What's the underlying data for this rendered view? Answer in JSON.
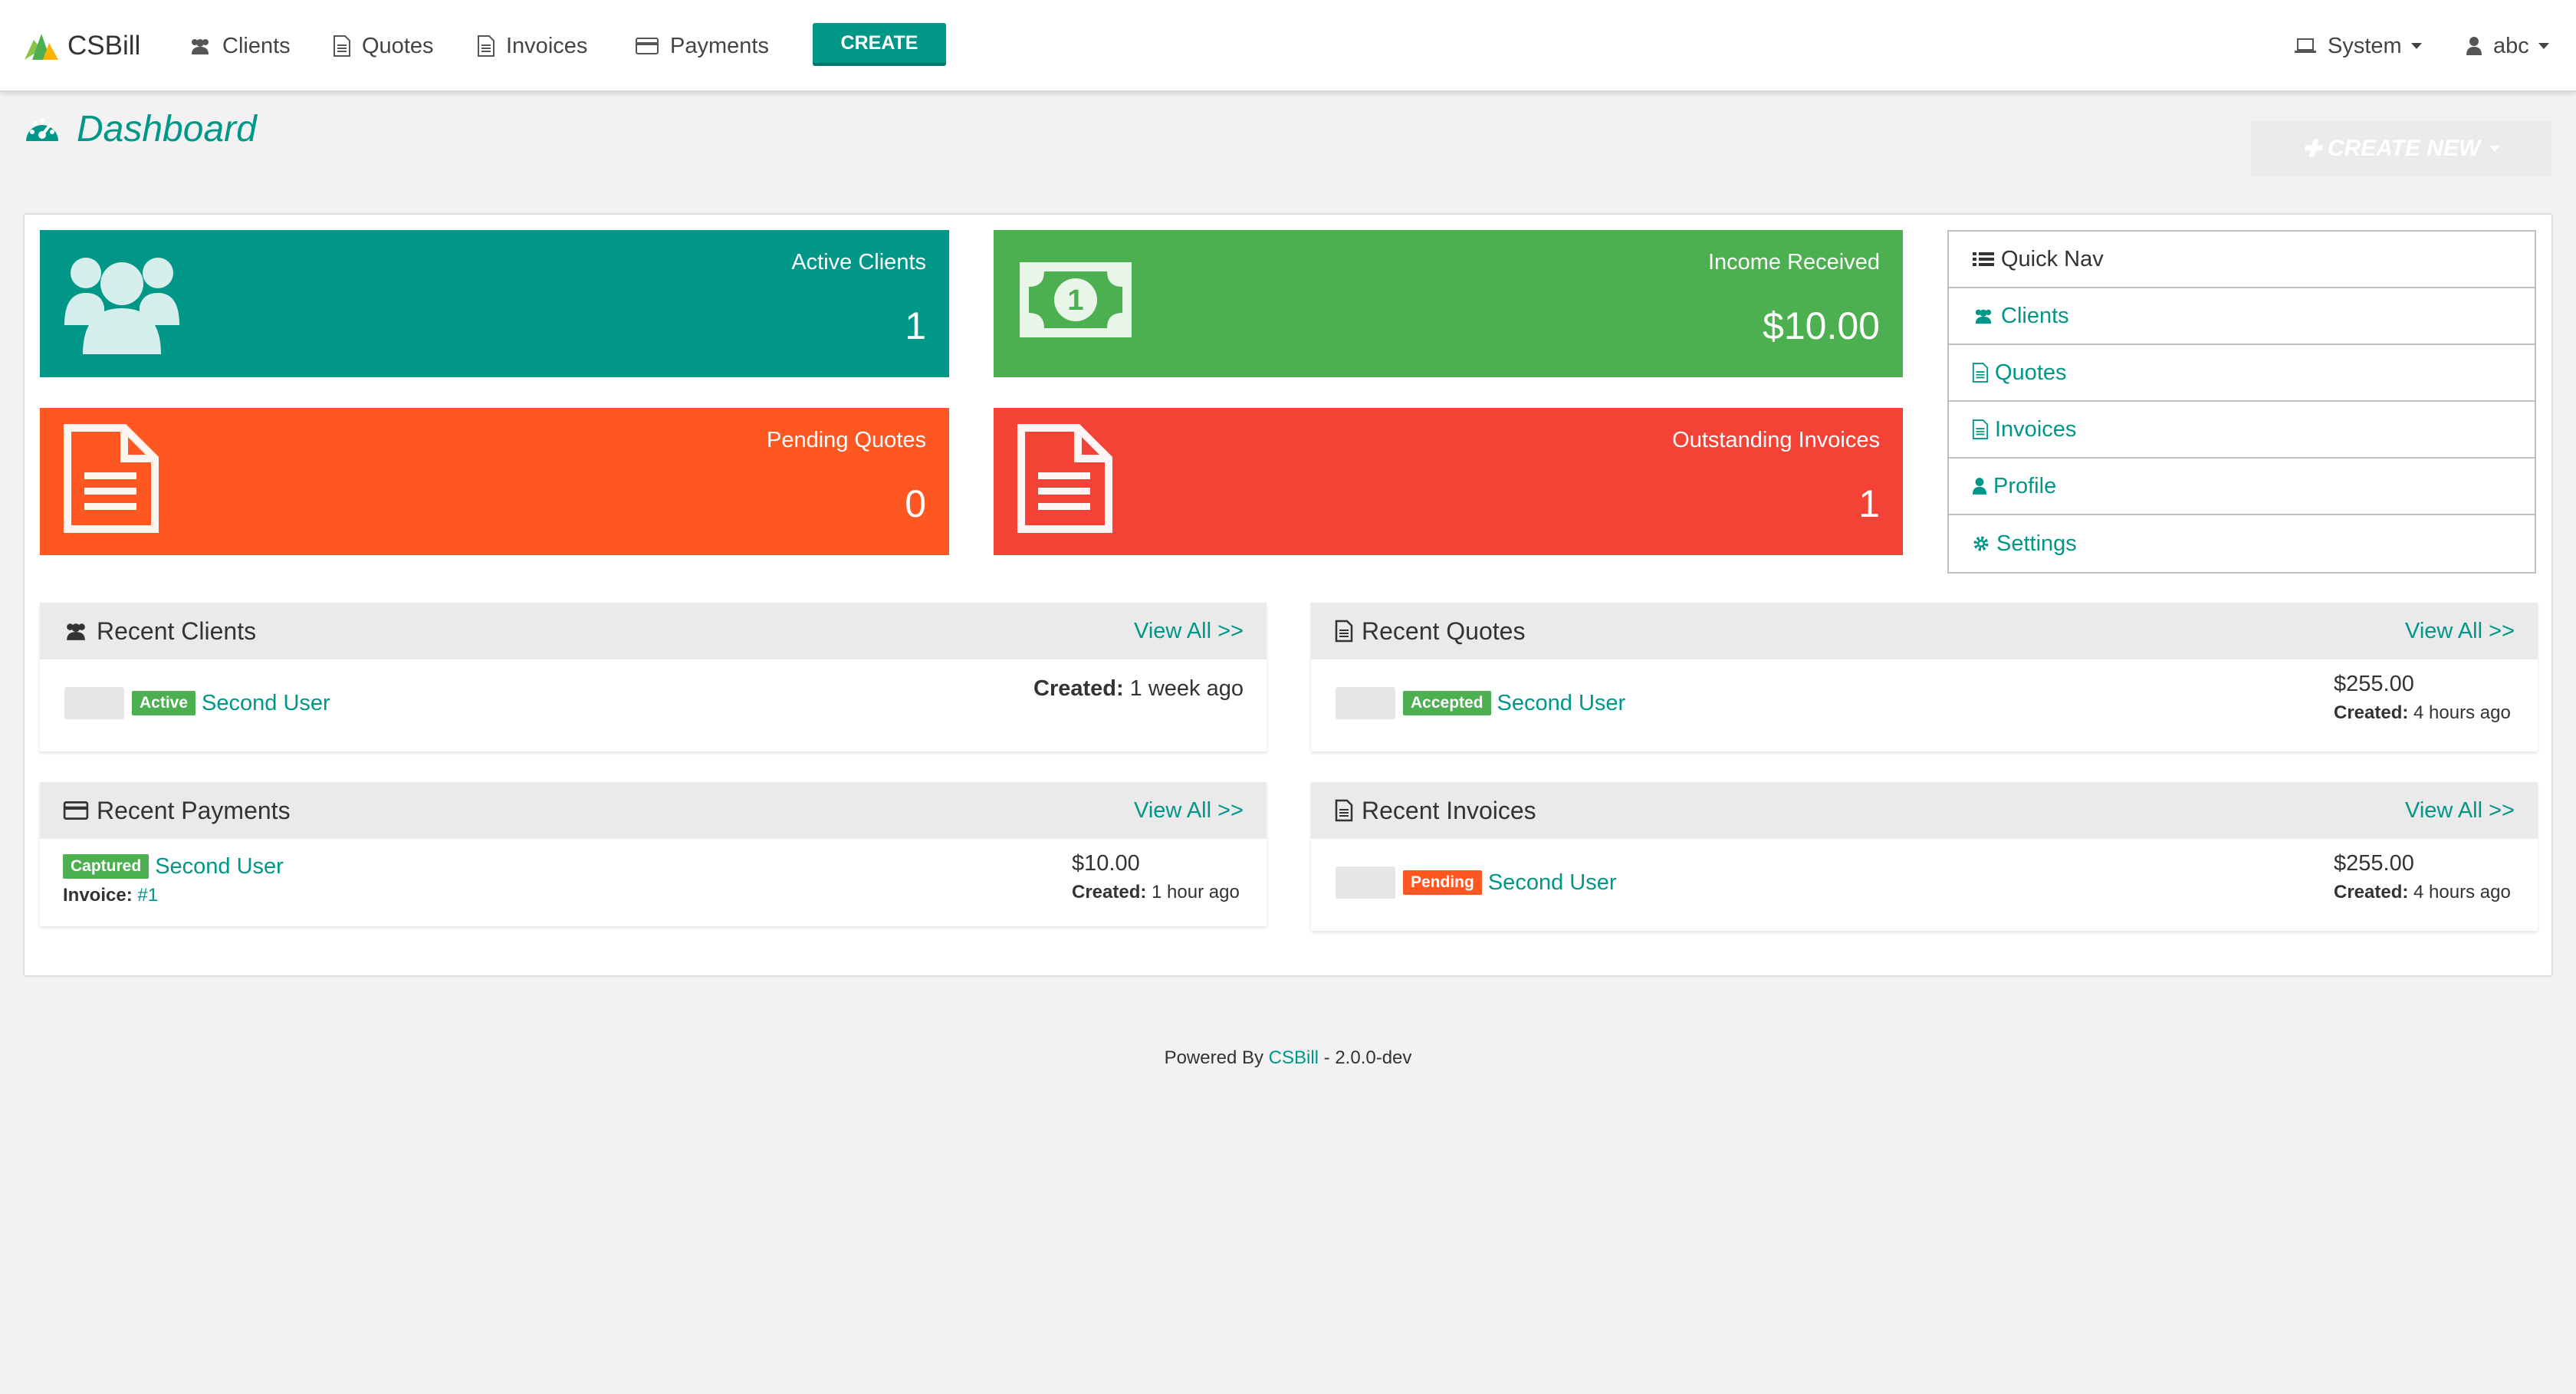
{
  "app": {
    "name": "CSBill"
  },
  "nav": {
    "clients": "Clients",
    "quotes": "Quotes",
    "invoices": "Invoices",
    "payments": "Payments",
    "create": "CREATE",
    "system": "System",
    "user": "abc"
  },
  "header": {
    "title": "Dashboard",
    "create_new": "CREATE NEW"
  },
  "tiles": {
    "active_clients": {
      "label": "Active Clients",
      "value": "1"
    },
    "income_received": {
      "label": "Income Received",
      "value": "$10.00"
    },
    "pending_quotes": {
      "label": "Pending Quotes",
      "value": "0"
    },
    "outstanding_invoices": {
      "label": "Outstanding Invoices",
      "value": "1"
    }
  },
  "quick_nav": {
    "title": "Quick Nav",
    "items": [
      "Clients",
      "Quotes",
      "Invoices",
      "Profile",
      "Settings"
    ]
  },
  "recent_clients": {
    "title": "Recent Clients",
    "view_all": "View All >>",
    "row": {
      "status": "Active",
      "name": "Second User",
      "created_label": "Created:",
      "created_value": "1 week ago"
    }
  },
  "recent_quotes": {
    "title": "Recent Quotes",
    "view_all": "View All >>",
    "row": {
      "status": "Accepted",
      "name": "Second User",
      "amount": "$255.00",
      "created_label": "Created:",
      "created_value": "4 hours ago"
    }
  },
  "recent_payments": {
    "title": "Recent Payments",
    "view_all": "View All >>",
    "row": {
      "status": "Captured",
      "name": "Second User",
      "invoice_label": "Invoice:",
      "invoice_value": "#1",
      "amount": "$10.00",
      "created_label": "Created:",
      "created_value": "1 hour ago"
    }
  },
  "recent_invoices": {
    "title": "Recent Invoices",
    "view_all": "View All >>",
    "row": {
      "status": "Pending",
      "name": "Second User",
      "amount": "$255.00",
      "created_label": "Created:",
      "created_value": "4 hours ago"
    }
  },
  "footer": {
    "prefix": "Powered By",
    "link": "CSBill",
    "suffix": "- 2.0.0-dev"
  },
  "colors": {
    "accent": "#009688",
    "success": "#4caf50",
    "warning": "#ff5722",
    "danger": "#f44336"
  }
}
